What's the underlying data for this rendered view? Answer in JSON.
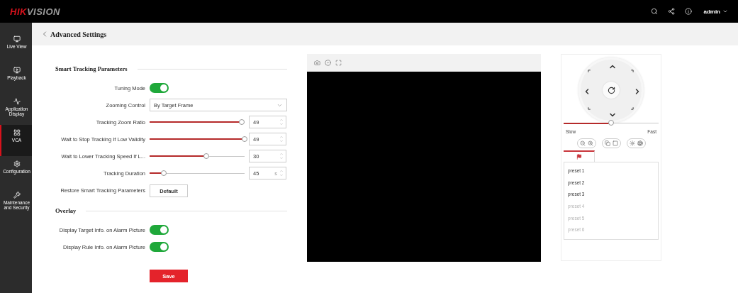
{
  "brand": {
    "strong": "HIK",
    "rest": "VISION"
  },
  "user": "admin",
  "sidebar": [
    {
      "label": "Live View",
      "selected": false
    },
    {
      "label": "Playback",
      "selected": false
    },
    {
      "label": "Application Display",
      "selected": false
    },
    {
      "label": "VCA",
      "selected": true
    },
    {
      "label": "Configuration",
      "selected": false
    },
    {
      "label": "Maintenance and Security",
      "selected": false
    }
  ],
  "page_title": "Advanced Settings",
  "sections": [
    {
      "title": "Smart Tracking Parameters",
      "rows": [
        {
          "kind": "toggle",
          "label": "Tuning Mode",
          "on": true
        },
        {
          "kind": "select",
          "label": "Zooming Control",
          "value": "By Target Frame"
        },
        {
          "kind": "slider",
          "label": "Tracking Zoom Ratio",
          "level": 0.97,
          "value": "49"
        },
        {
          "kind": "slider",
          "label": "Wait to Stop Tracking If Low Validity",
          "level": 1.0,
          "value": "49"
        },
        {
          "kind": "slider",
          "label": "Wait to Lower Tracking Speed If L...",
          "level": 0.6,
          "value": "30"
        },
        {
          "kind": "slider",
          "label": "Tracking Duration",
          "level": 0.15,
          "value": "45",
          "unit": "s"
        },
        {
          "kind": "button",
          "label": "Restore Smart Tracking Parameters",
          "value": "Default"
        }
      ]
    },
    {
      "title": "Overlay",
      "rows": [
        {
          "kind": "toggle",
          "label": "Display Target Info. on Alarm Picture",
          "on": true
        },
        {
          "kind": "toggle",
          "label": "Display Rule Info. on Alarm Picture",
          "on": true
        }
      ]
    }
  ],
  "save": "Save",
  "ptz": {
    "speed": {
      "level": 0.5,
      "min_label": "Slow",
      "max_label": "Fast"
    },
    "presets": [
      {
        "label": "preset 1",
        "disabled": false
      },
      {
        "label": "preset 2",
        "disabled": false
      },
      {
        "label": "preset 3",
        "disabled": false
      },
      {
        "label": "preset 4",
        "disabled": true
      },
      {
        "label": "preset 5",
        "disabled": true
      },
      {
        "label": "preset 6",
        "disabled": true
      }
    ]
  }
}
